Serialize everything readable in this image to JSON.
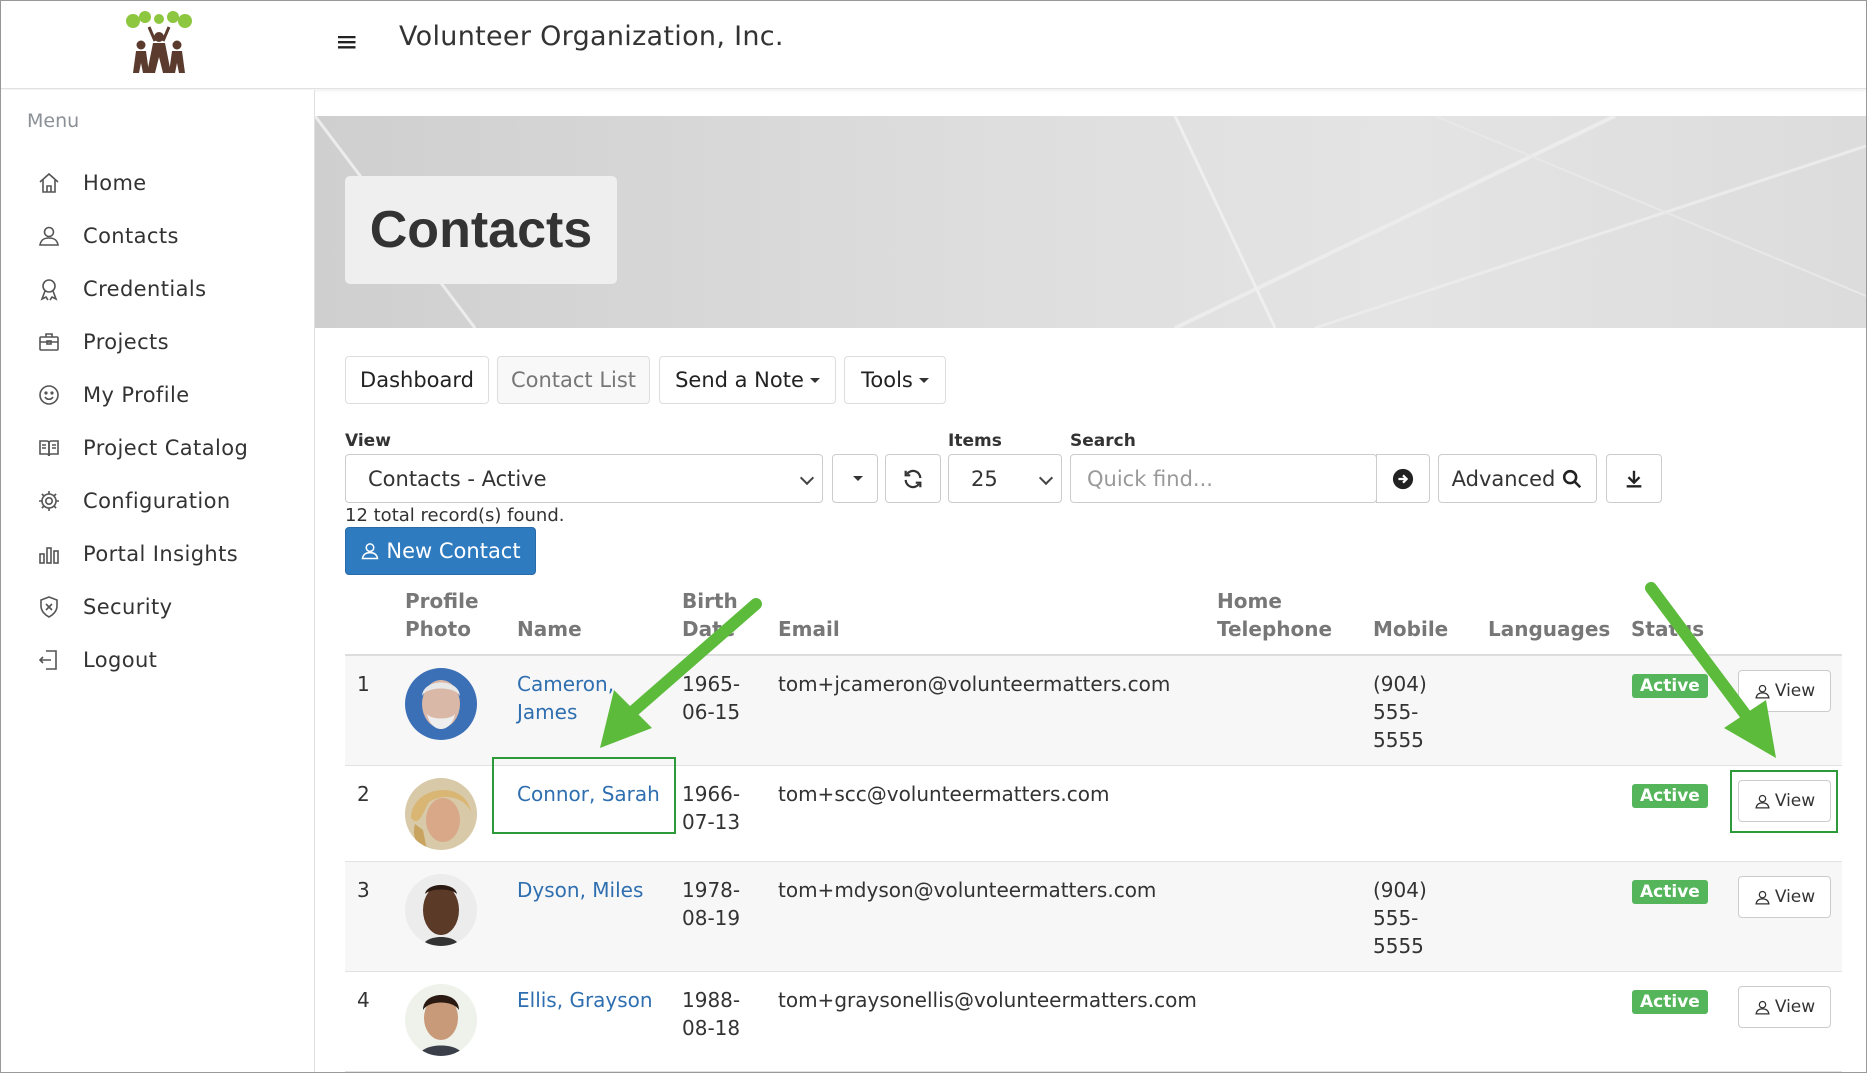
{
  "header": {
    "app_title": "Volunteer Organization, Inc.",
    "menu_icon": "hamburger-icon"
  },
  "sidebar": {
    "menu_label": "Menu",
    "items": [
      {
        "label": "Home",
        "icon": "home-icon"
      },
      {
        "label": "Contacts",
        "icon": "contacts-icon"
      },
      {
        "label": "Credentials",
        "icon": "credentials-icon"
      },
      {
        "label": "Projects",
        "icon": "projects-icon"
      },
      {
        "label": "My Profile",
        "icon": "smiley-icon"
      },
      {
        "label": "Project Catalog",
        "icon": "catalog-icon"
      },
      {
        "label": "Configuration",
        "icon": "gear-icon"
      },
      {
        "label": "Portal Insights",
        "icon": "bar-chart-icon"
      },
      {
        "label": "Security",
        "icon": "shield-icon"
      },
      {
        "label": "Logout",
        "icon": "logout-icon"
      }
    ]
  },
  "page": {
    "title": "Contacts"
  },
  "tabs": {
    "dashboard": "Dashboard",
    "contact_list": "Contact List",
    "send_note": "Send a Note",
    "tools": "Tools"
  },
  "filters": {
    "view_label": "View",
    "view_value": "Contacts - Active",
    "items_label": "Items",
    "items_value": "25",
    "search_label": "Search",
    "search_placeholder": "Quick find...",
    "advanced_label": "Advanced"
  },
  "records_text": "12 total record(s) found.",
  "new_contact_label": "New Contact",
  "table": {
    "headers": {
      "photo_line1": "Profile",
      "photo_line2": "Photo",
      "name": "Name",
      "birth_line1": "Birth",
      "birth_line2": "Date",
      "email": "Email",
      "home_line1": "Home",
      "home_line2": "Telephone",
      "mobile": "Mobile",
      "languages": "Languages",
      "status": "Status"
    },
    "view_label": "View",
    "rows": [
      {
        "num": "1",
        "name_line1": "Cameron,",
        "name_line2": "James",
        "birth_line1": "1965-",
        "birth_line2": "06-15",
        "email": "tom+jcameron@volunteermatters.com",
        "mobile_line1": "(904)",
        "mobile_line2": "555-",
        "mobile_line3": "5555",
        "status": "Active"
      },
      {
        "num": "2",
        "name_line1": "Connor, Sarah",
        "name_line2": "",
        "birth_line1": "1966-",
        "birth_line2": "07-13",
        "email": "tom+scc@volunteermatters.com",
        "mobile_line1": "",
        "mobile_line2": "",
        "mobile_line3": "",
        "status": "Active"
      },
      {
        "num": "3",
        "name_line1": "Dyson, Miles",
        "name_line2": "",
        "birth_line1": "1978-",
        "birth_line2": "08-19",
        "email": "tom+mdyson@volunteermatters.com",
        "mobile_line1": "(904)",
        "mobile_line2": "555-",
        "mobile_line3": "5555",
        "status": "Active"
      },
      {
        "num": "4",
        "name_line1": "Ellis, Grayson",
        "name_line2": "",
        "birth_line1": "1988-",
        "birth_line2": "08-18",
        "email": "tom+graysonellis@volunteermatters.com",
        "mobile_line1": "",
        "mobile_line2": "",
        "mobile_line3": "",
        "status": "Active"
      }
    ]
  },
  "colors": {
    "accent": "#2f7bc0",
    "status_active": "#55b55a",
    "link": "#2f6fb0",
    "annotation": "#5dbb3c"
  }
}
